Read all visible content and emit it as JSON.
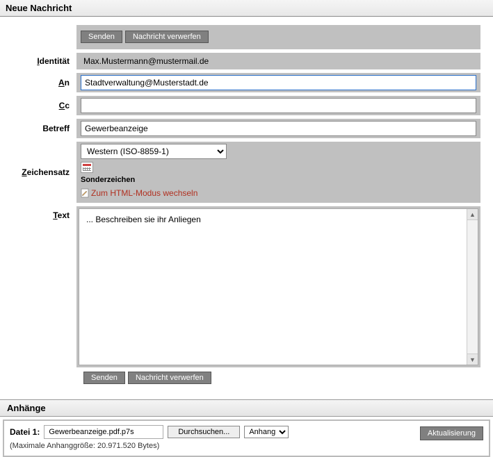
{
  "title": "Neue Nachricht",
  "buttons": {
    "send": "Senden",
    "discard": "Nachricht verwerfen",
    "browse": "Durchsuchen...",
    "update": "Aktualisierung"
  },
  "labels": {
    "identity": "Identität",
    "identity_ul": "I",
    "to": "An",
    "to_ul": "A",
    "cc": "Cc",
    "cc_ul": "C",
    "subject": "Betreff",
    "charset": "Zeichensatz",
    "charset_ul": "Z",
    "text": "Text",
    "text_ul": "T",
    "sonderzeichen": "Sonderzeichen",
    "html_mode": "Zum HTML-Modus wechseln",
    "attachments": "Anhänge",
    "file1": "Datei 1:",
    "attach_action": "Anhang"
  },
  "values": {
    "identity": "Max.Mustermann@mustermail.de",
    "to": "Stadtverwaltung@Musterstadt.de",
    "cc": "",
    "subject": "Gewerbeanzeige",
    "charset": "Western (ISO-8859-1)",
    "body": "... Beschreiben sie ihr Anliegen",
    "file1": "Gewerbeanzeige.pdf.p7s",
    "max_size": "(Maximale Anhanggröße: 20.971.520 Bytes)"
  }
}
